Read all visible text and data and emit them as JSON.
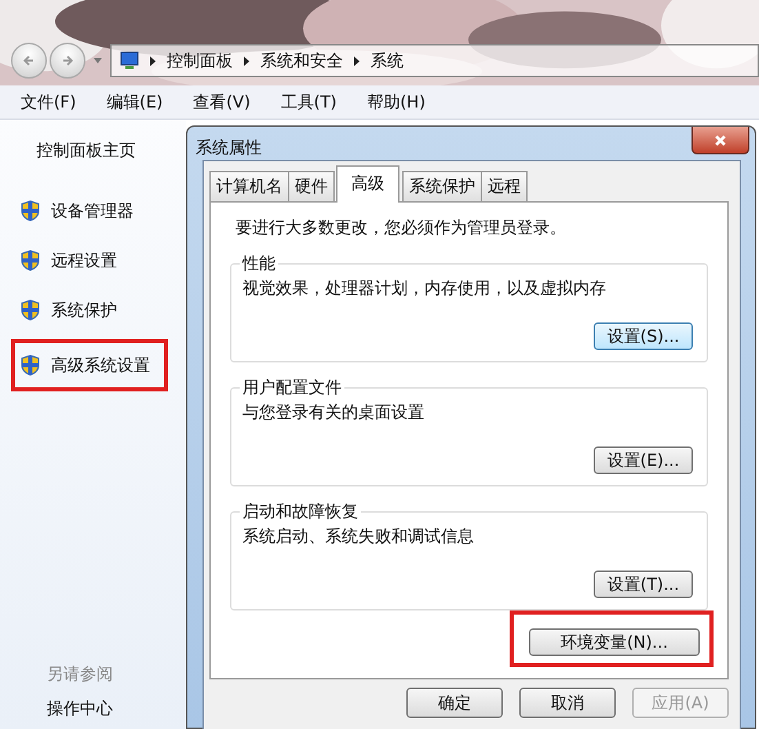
{
  "address_bar": {
    "crumbs": [
      "控制面板",
      "系统和安全",
      "系统"
    ]
  },
  "menu": [
    "文件(F)",
    "编辑(E)",
    "查看(V)",
    "工具(T)",
    "帮助(H)"
  ],
  "sidebar": {
    "home": "控制面板主页",
    "items": [
      {
        "label": "设备管理器",
        "highlighted": false
      },
      {
        "label": "远程设置",
        "highlighted": false
      },
      {
        "label": "系统保护",
        "highlighted": false
      },
      {
        "label": "高级系统设置",
        "highlighted": true
      }
    ],
    "see_also": "另请参阅",
    "links": [
      "操作中心"
    ]
  },
  "dialog": {
    "title": "系统属性",
    "tabs": [
      {
        "label": "计算机名",
        "selected": false
      },
      {
        "label": "硬件",
        "selected": false
      },
      {
        "label": "高级",
        "selected": true
      },
      {
        "label": "系统保护",
        "selected": false
      },
      {
        "label": "远程",
        "selected": false
      }
    ],
    "notice": "要进行大多数更改，您必须作为管理员登录。",
    "groups": [
      {
        "title": "性能",
        "description": "视觉效果，处理器计划，内存使用，以及虚拟内存",
        "button": "设置(S)...",
        "focused": true
      },
      {
        "title": "用户配置文件",
        "description": "与您登录有关的桌面设置",
        "button": "设置(E)...",
        "focused": false
      },
      {
        "title": "启动和故障恢复",
        "description": "系统启动、系统失败和调试信息",
        "button": "设置(T)...",
        "focused": false
      }
    ],
    "env_button": {
      "label": "环境变量(N)...",
      "highlighted": true
    },
    "buttons": [
      {
        "label": "确定",
        "disabled": false
      },
      {
        "label": "取消",
        "disabled": false
      },
      {
        "label": "应用(A)",
        "disabled": true
      }
    ]
  }
}
